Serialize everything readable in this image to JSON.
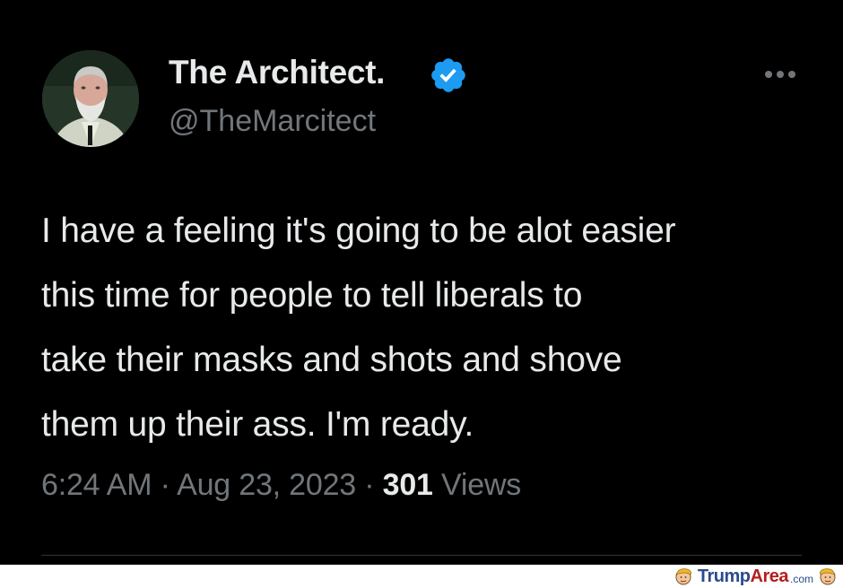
{
  "author": {
    "display_name": "The Architect.",
    "handle": "@TheMarcitect",
    "verified": true,
    "avatar_icon": "profile-photo"
  },
  "menu": {
    "icon": "more-horizontal-icon"
  },
  "tweet": {
    "text_lines": [
      "I have a feeling it's going to be alot easier",
      "this time for people to tell liberals to",
      "take their masks and shots and shove",
      "them up their ass. I'm ready."
    ]
  },
  "meta": {
    "time": "6:24 AM",
    "separator": "·",
    "date": "Aug 23, 2023",
    "views_count": "301",
    "views_label": "Views"
  },
  "watermark": {
    "brand_first": "Trump",
    "brand_second": "Area",
    "tld": ".com"
  },
  "colors": {
    "background": "#000000",
    "primary_text": "#e7e9ea",
    "secondary_text": "#71767b",
    "verified": "#1d9bf0"
  }
}
